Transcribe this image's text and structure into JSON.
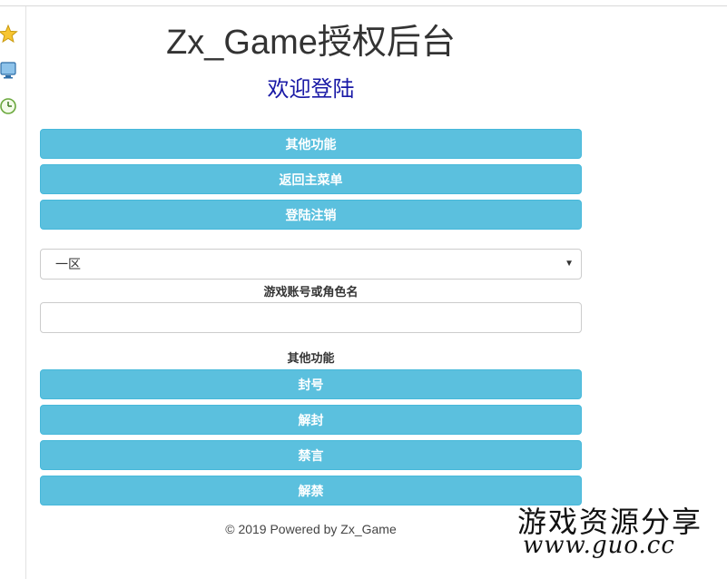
{
  "header": {
    "title": "Zx_Game授权后台",
    "subtitle": "欢迎登陆"
  },
  "sidebar": {
    "icons": [
      "star-icon",
      "monitor-icon",
      "clock-icon"
    ]
  },
  "top_buttons": [
    {
      "label": "其他功能"
    },
    {
      "label": "返回主菜单"
    },
    {
      "label": "登陆注销"
    }
  ],
  "server_select": {
    "value": "一区"
  },
  "account_field": {
    "label": "游戏账号或角色名",
    "value": ""
  },
  "actions": {
    "label": "其他功能",
    "buttons": [
      {
        "label": "封号"
      },
      {
        "label": "解封"
      },
      {
        "label": "禁言"
      },
      {
        "label": "解禁"
      }
    ]
  },
  "footer": {
    "text": "© 2019 Powered by Zx_Game"
  },
  "watermark": {
    "line1": "游戏资源分享",
    "line2": "www.guo.cc"
  },
  "colors": {
    "button_bg": "#5bc0de",
    "subtitle": "#1a1aa6"
  }
}
